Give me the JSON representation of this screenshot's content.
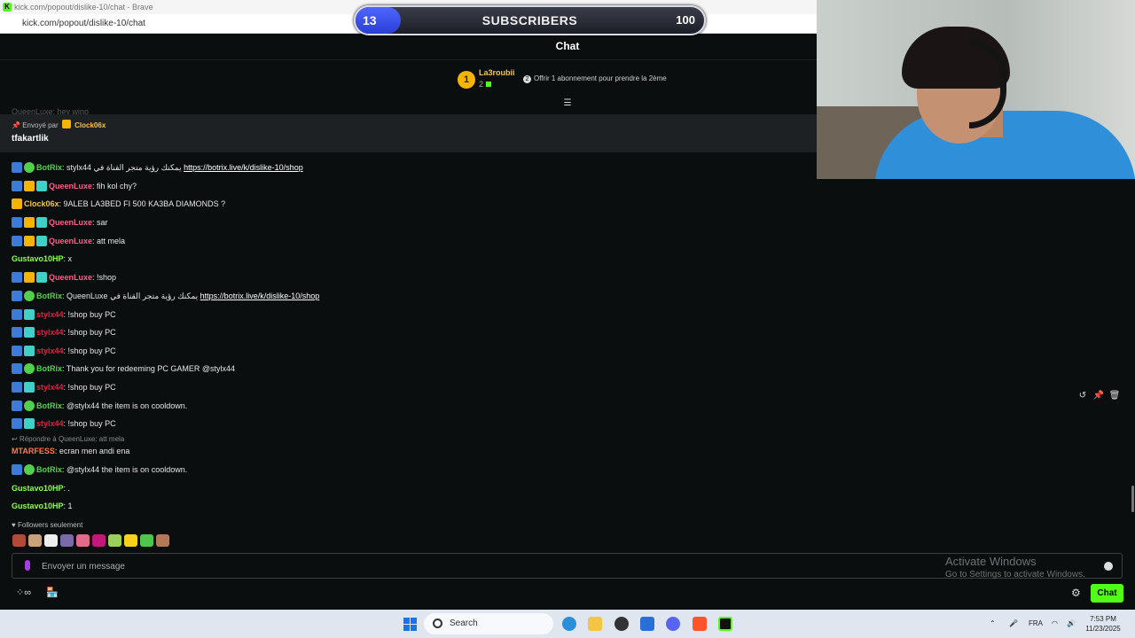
{
  "browser": {
    "title": "kick.com/popout/dislike-10/chat - Brave",
    "url": "kick.com/popout/dislike-10/chat"
  },
  "overlay": {
    "current": "13",
    "label": "SUBSCRIBERS",
    "goal": "100",
    "progress_fraction": 0.13
  },
  "chat": {
    "title": "Chat",
    "leaderboard": {
      "rank": "1",
      "name": "La3roubii",
      "count": "2"
    },
    "offer_text": "Offrir 1 abonnement pour prendre la 2ème",
    "pinned": {
      "ghost": "QueenLuxe: hey wino",
      "sent_by_label": "Envoyé par",
      "sender": "Clock06x",
      "text": "tfakartlik"
    },
    "messages": [
      {
        "badges": [
          "pin",
          "bot"
        ],
        "user": "BotRix",
        "user_color": "#53d04a",
        "text": "stylx44 يمكنك رؤية متجر القناة في ",
        "link": "https://botrix.live/k/dislike-10/shop"
      },
      {
        "badges": [
          "pin",
          "crown",
          "sub"
        ],
        "user": "QueenLuxe",
        "user_color": "#ff5c8a",
        "text": "fih kol chy?",
        "link": ""
      },
      {
        "badges": [
          "crown"
        ],
        "user": "Clock06x",
        "user_color": "#f4c542",
        "text": "9ALEB LA3BED FI 500 KA3BA DIAMONDS ?",
        "link": ""
      },
      {
        "badges": [
          "pin",
          "crown",
          "sub"
        ],
        "user": "QueenLuxe",
        "user_color": "#ff5c8a",
        "text": "sar",
        "link": ""
      },
      {
        "badges": [
          "pin",
          "crown",
          "sub"
        ],
        "user": "QueenLuxe",
        "user_color": "#ff5c8a",
        "text": "att mela",
        "link": ""
      },
      {
        "badges": [],
        "user": "Gustavo10HP",
        "user_color": "#8cff4a",
        "text": "x",
        "link": ""
      },
      {
        "badges": [
          "pin",
          "crown",
          "sub"
        ],
        "user": "QueenLuxe",
        "user_color": "#ff5c8a",
        "text": "!shop",
        "link": ""
      },
      {
        "badges": [
          "pin",
          "bot"
        ],
        "user": "BotRix",
        "user_color": "#53d04a",
        "text": "QueenLuxe يمكنك رؤية متجر القناة في ",
        "link": "https://botrix.live/k/dislike-10/shop"
      },
      {
        "badges": [
          "pin",
          "sub"
        ],
        "user": "stylx44",
        "user_color": "#e0223e",
        "text": "!shop buy PC",
        "link": ""
      },
      {
        "badges": [
          "pin",
          "sub"
        ],
        "user": "stylx44",
        "user_color": "#e0223e",
        "text": "!shop buy PC",
        "link": ""
      },
      {
        "badges": [
          "pin",
          "sub"
        ],
        "user": "stylx44",
        "user_color": "#e0223e",
        "text": "!shop buy PC",
        "link": ""
      },
      {
        "badges": [
          "pin",
          "bot"
        ],
        "user": "BotRix",
        "user_color": "#53d04a",
        "text": "Thank you for redeeming PC GAMER @stylx44",
        "link": ""
      },
      {
        "badges": [
          "pin",
          "sub"
        ],
        "user": "stylx44",
        "user_color": "#e0223e",
        "text": "!shop buy PC",
        "link": ""
      },
      {
        "badges": [
          "pin",
          "bot"
        ],
        "user": "BotRix",
        "user_color": "#53d04a",
        "text": "@stylx44 the item is on cooldown.",
        "link": ""
      },
      {
        "badges": [
          "pin",
          "sub"
        ],
        "user": "stylx44",
        "user_color": "#e0223e",
        "text": "!shop buy PC",
        "link": ""
      },
      {
        "badges": [],
        "user": "MTARFESS",
        "user_color": "#ff7a4a",
        "text": "ecran men andi ena",
        "link": ""
      },
      {
        "badges": [
          "pin",
          "bot"
        ],
        "user": "BotRix",
        "user_color": "#53d04a",
        "text": "@stylx44 the item is on cooldown.",
        "link": ""
      },
      {
        "badges": [],
        "user": "Gustavo10HP",
        "user_color": "#8cff4a",
        "text": ".",
        "link": ""
      },
      {
        "badges": [],
        "user": "Gustavo10HP",
        "user_color": "#8cff4a",
        "text": "1",
        "link": ""
      }
    ],
    "reply_hint": "Répondre à QueenLuxe: att mela",
    "followers_only": "Followers seulement",
    "emote_colors": [
      "#b24a3a",
      "#c9a27c",
      "#eeeeee",
      "#7b6aa8",
      "#e46a8c",
      "#c2187a",
      "#9bd15a",
      "#f7d21c",
      "#4ec64e",
      "#b07a5a"
    ],
    "input_placeholder": "Envoyer un message",
    "send_label": "Chat"
  },
  "watermark": {
    "line1": "Activate Windows",
    "line2": "Go to Settings to activate Windows."
  },
  "taskbar": {
    "search": "Search",
    "lang": "FRA",
    "time": "7:53 PM",
    "date": "11/23/2025"
  }
}
